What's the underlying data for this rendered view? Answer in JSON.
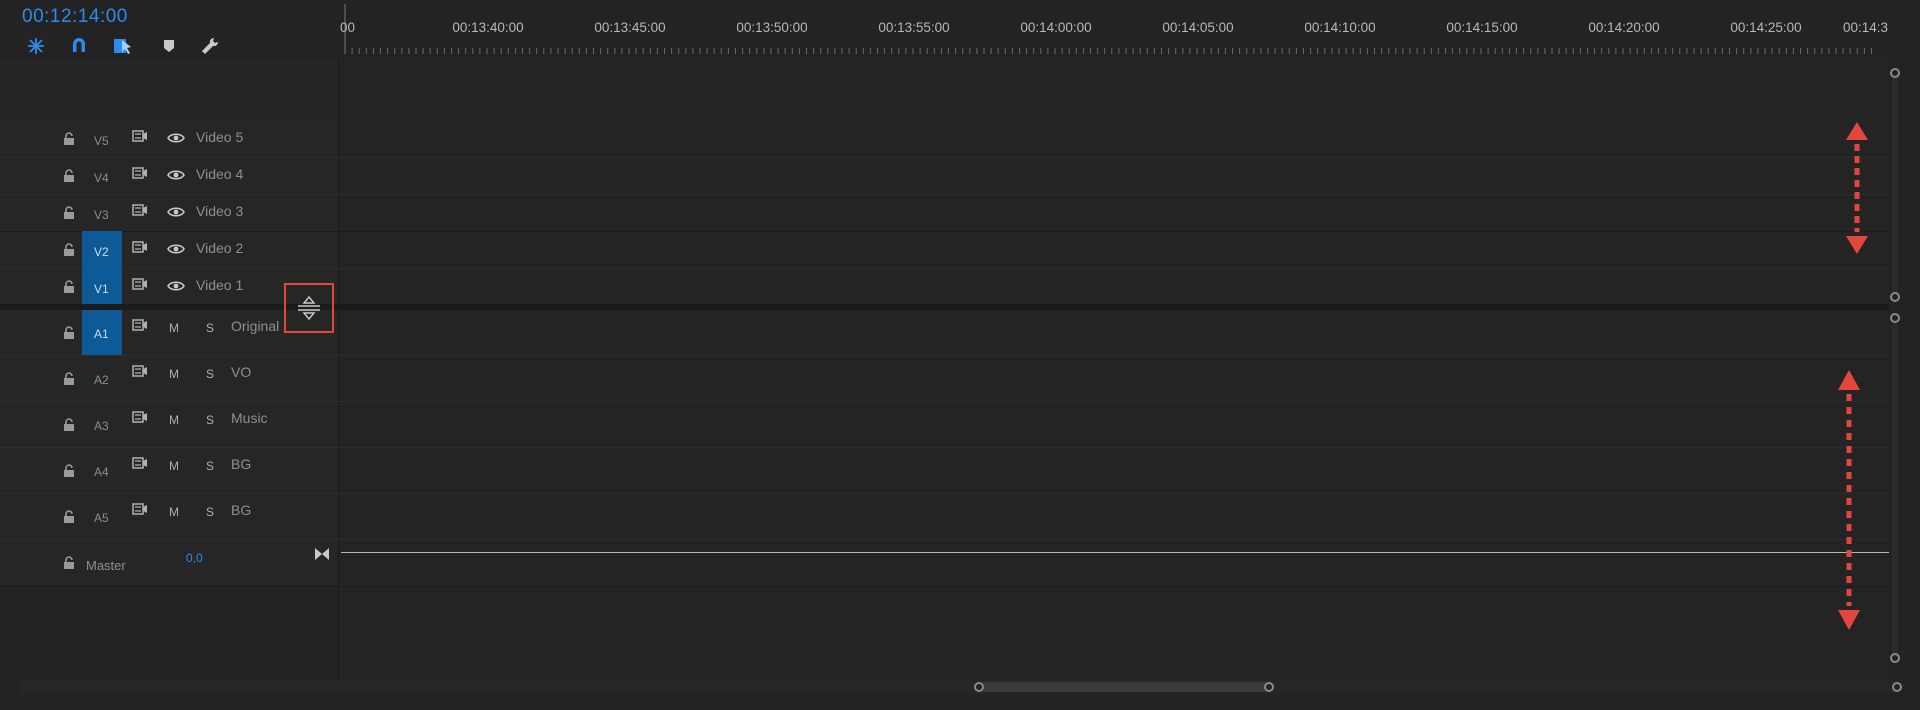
{
  "header": {
    "timecode": "00:12:14:00",
    "tools": [
      "snap-icon",
      "magnet-icon",
      "linked-selection-icon",
      "marker-icon",
      "wrench-icon"
    ]
  },
  "ruler": {
    "labels": [
      "00",
      "00:13:40:00",
      "00:13:45:00",
      "00:13:50:00",
      "00:13:55:00",
      "00:14:00:00",
      "00:14:05:00",
      "00:14:10:00",
      "00:14:15:00",
      "00:14:20:00",
      "00:14:25:00",
      "00:14:3"
    ]
  },
  "video_tracks": [
    {
      "id": "V5",
      "label": "Video 5",
      "targeted": false
    },
    {
      "id": "V4",
      "label": "Video 4",
      "targeted": false
    },
    {
      "id": "V3",
      "label": "Video 3",
      "targeted": false
    },
    {
      "id": "V2",
      "label": "Video 2",
      "targeted": true
    },
    {
      "id": "V1",
      "label": "Video 1",
      "targeted": true
    }
  ],
  "audio_tracks": [
    {
      "id": "A1",
      "label": "Original",
      "mute": "M",
      "solo": "S",
      "targeted": true
    },
    {
      "id": "A2",
      "label": "VO",
      "mute": "M",
      "solo": "S",
      "targeted": false
    },
    {
      "id": "A3",
      "label": "Music",
      "mute": "M",
      "solo": "S",
      "targeted": false
    },
    {
      "id": "A4",
      "label": "BG",
      "mute": "M",
      "solo": "S",
      "targeted": false
    },
    {
      "id": "A5",
      "label": "BG",
      "mute": "M",
      "solo": "S",
      "targeted": false
    }
  ],
  "master": {
    "label": "Master",
    "value": "0,0"
  },
  "colors": {
    "accent": "#2d8ceb",
    "target": "#0d5a96",
    "annotation": "#e2473e"
  }
}
